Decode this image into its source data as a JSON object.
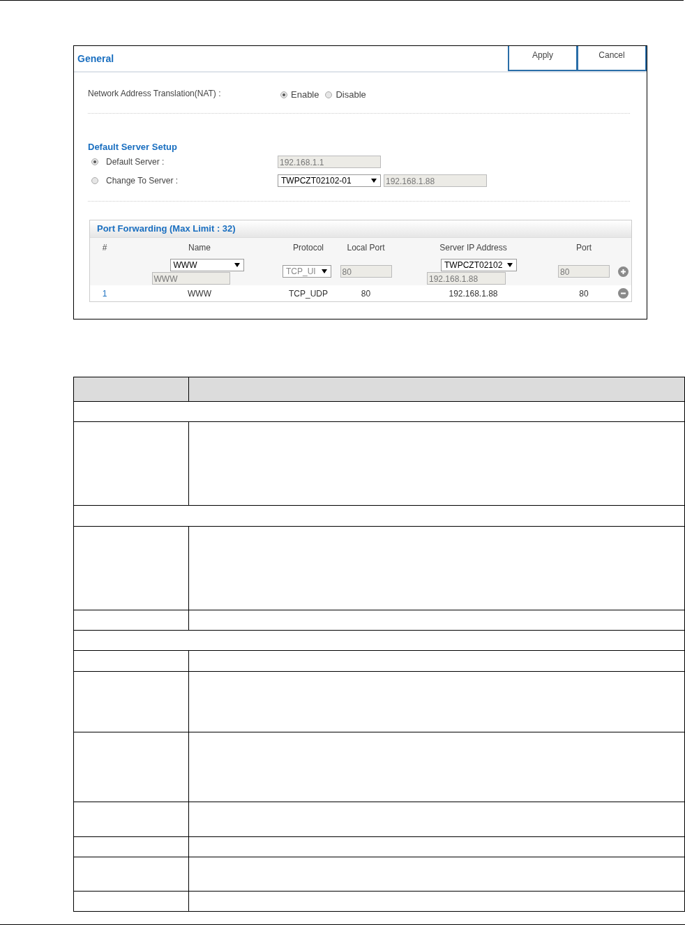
{
  "settings_panel": {
    "title": "General",
    "buttons": [
      {
        "label": "Apply"
      },
      {
        "label": "Cancel"
      }
    ],
    "nat": {
      "label": "Network Address Translation(NAT) :",
      "options": [
        {
          "label": "Enable",
          "selected": true
        },
        {
          "label": "Disable",
          "selected": false
        }
      ]
    },
    "default_server_setup": {
      "title": "Default Server Setup",
      "options": [
        {
          "label": "Default Server :",
          "selected": true,
          "fields": [
            {
              "kind": "input",
              "value": "192.168.1.1"
            }
          ]
        },
        {
          "label": "Change To Server :",
          "selected": false,
          "fields": [
            {
              "kind": "select",
              "value": "TWPCZT02102-01"
            },
            {
              "kind": "input",
              "value": "192.168.1.88"
            }
          ]
        }
      ]
    },
    "port_forwarding": {
      "title": "Port Forwarding (Max Limit : 32)",
      "columns": [
        "#",
        "Name",
        "Protocol",
        "Local Port",
        "Server IP Address",
        "Port"
      ],
      "new_entry": {
        "name_select": "WWW",
        "name": "WWW",
        "protocol": "TCP_UI",
        "local_port": "80",
        "server_select": "TWPCZT02102",
        "server_ip": "192.168.1.88",
        "port": "80"
      },
      "rows": [
        {
          "cells": [
            "1",
            "WWW",
            "TCP_UDP",
            "80",
            "192.168.1.88",
            "80"
          ]
        }
      ]
    }
  },
  "description_table": {
    "rows": [
      {
        "kind": "header"
      },
      {
        "kind": "section"
      },
      {
        "kind": "entry"
      },
      {
        "kind": "section"
      },
      {
        "kind": "entry"
      },
      {
        "kind": "entry"
      },
      {
        "kind": "section"
      },
      {
        "kind": "entry"
      },
      {
        "kind": "entry"
      },
      {
        "kind": "entry"
      },
      {
        "kind": "entry"
      },
      {
        "kind": "entry"
      },
      {
        "kind": "entry"
      },
      {
        "kind": "entry"
      }
    ]
  }
}
